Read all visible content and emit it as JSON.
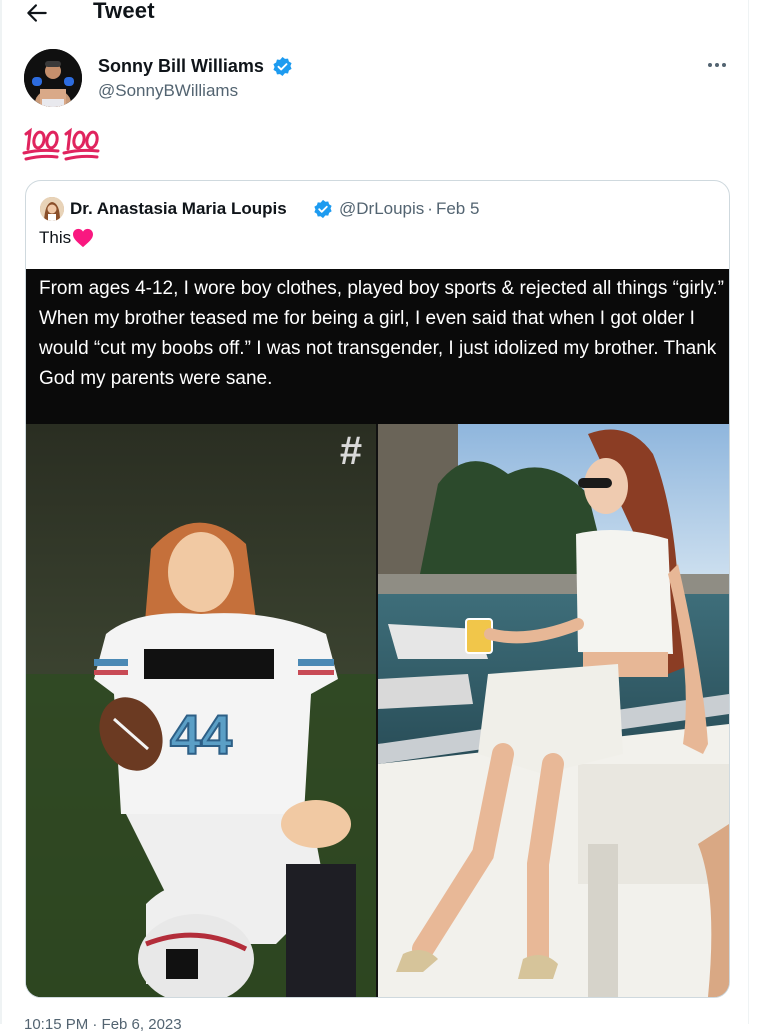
{
  "header": {
    "title": "Tweet",
    "back_icon": "arrow-left-icon"
  },
  "tweet": {
    "author_name": "Sonny Bill Williams",
    "author_handle": "@SonnyBWilliams",
    "verified": true,
    "more_icon": "more-horizontal-icon",
    "text_emoji": [
      "hundred-points-emoji",
      "hundred-points-emoji"
    ],
    "timestamp_partial": "10:15 PM · Feb 6, 2023"
  },
  "quoted_tweet": {
    "author_name": "Dr. Anastasia Maria Loupis",
    "author_handle": "@DrLoupis",
    "separator": "·",
    "date": "Feb 5",
    "text": "This",
    "text_emoji": "red-heart-emoji",
    "image_caption": "From ages 4-12, I wore boy clothes, played boy sports & rejected all things “girly.” When my brother teased me for being a girl, I even said that when I got older I would “cut my boobs off.” I was not transgender, I just idolized my brother. Thank God my parents were sane.",
    "photo_left_watermark": "#",
    "photo_left_jersey_number": "44"
  },
  "colors": {
    "verified_blue": "#1d9bf0",
    "secondary_text": "#536471",
    "border": "#cfd9de",
    "hundred_red": "#e0245e",
    "heart_red": "#f91880"
  }
}
